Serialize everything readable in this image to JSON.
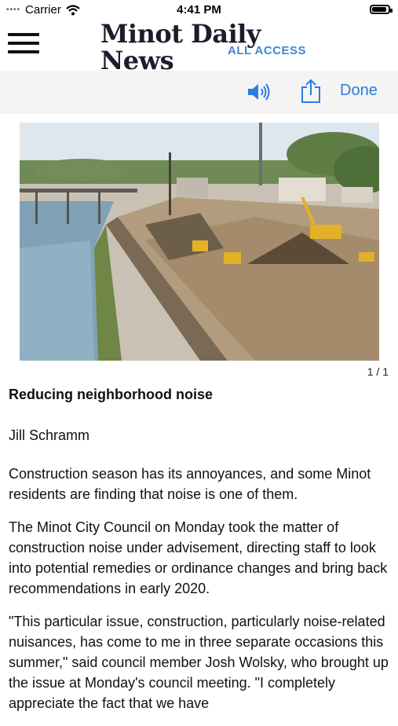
{
  "status_bar": {
    "carrier": "Carrier",
    "time": "4:41 PM",
    "battery_level": 0.9
  },
  "header": {
    "title": "Minot Daily News",
    "subtitle": "ALL ACCESS",
    "menu_icon": "hamburger-menu-icon",
    "accent_color": "#3d86d6"
  },
  "toolbar": {
    "speaker_icon": "speaker-icon",
    "share_icon": "share-icon",
    "done_label": "Done",
    "link_color": "#2a7de1"
  },
  "photo": {
    "counter": "1 / 1"
  },
  "article": {
    "headline": "Reducing neighborhood noise",
    "author": "Jill Schramm",
    "paragraphs": [
      "Construction season has its annoyances, and some Minot residents are finding that noise is one of them.",
      "The Minot City Council on Monday took the matter of construction noise under advisement, directing staff to look into potential remedies or ordinance changes and bring back recommendations in early 2020.",
      "\"This particular issue, construction, particularly noise-related nuisances, has come to me in three separate occasions this summer,\" said council member Josh Wolsky, who brought up the issue at Monday's council meeting. \"I completely appreciate the fact that we have"
    ]
  }
}
